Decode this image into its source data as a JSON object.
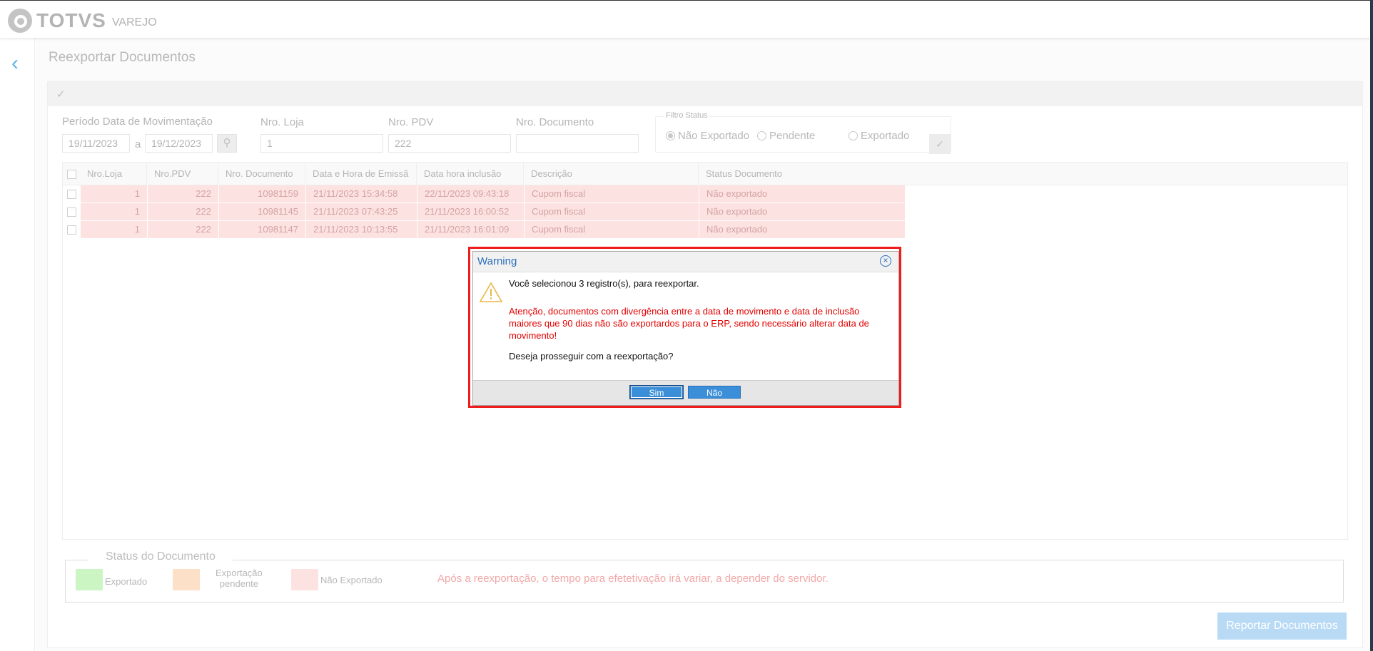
{
  "brand": {
    "name": "TOTVS",
    "sub": "VAREJO"
  },
  "page": {
    "title": "Reexportar Documentos"
  },
  "filters": {
    "periodo_label": "Período Data de Movimentação",
    "date_from": "19/11/2023",
    "date_sep": "a",
    "date_to": "19/12/2023",
    "loja_label": "Nro. Loja",
    "loja_value": "1",
    "pdv_label": "Nro. PDV",
    "pdv_value": "222",
    "documento_label": "Nro. Documento",
    "documento_value": "",
    "status_legend": "Filtro Status",
    "status_options": [
      "Não Exportado",
      "Pendente",
      "Exportado"
    ],
    "status_selected": "Não Exportado"
  },
  "grid": {
    "headers": [
      "Nro.Loja",
      "Nro.PDV",
      "Nro. Documento",
      "Data e Hora de Emissã",
      "Data hora inclusão",
      "Descrição",
      "Status Documento"
    ],
    "rows": [
      [
        "1",
        "222",
        "10981159",
        "21/11/2023 15:34:58",
        "22/11/2023 09:43:18",
        "Cupom fiscal",
        "Não exportado"
      ],
      [
        "1",
        "222",
        "10981145",
        "21/11/2023 07:43:25",
        "21/11/2023 16:00:52",
        "Cupom fiscal",
        "Não exportado"
      ],
      [
        "1",
        "222",
        "10981147",
        "21/11/2023 10:13:55",
        "21/11/2023 16:01:09",
        "Cupom fiscal",
        "Não exportado"
      ]
    ]
  },
  "status_doc": {
    "legend": "Status do Documento",
    "exportado": "Exportado",
    "pendente_1": "Exportação",
    "pendente_2": "pendente",
    "nao_exportado": "Não Exportado",
    "note": "Após a reexportação, o tempo para efetetivação irá variar, a depender do servidor.",
    "colors": {
      "exportado": "#ccf5c4",
      "pendente": "#fde0c8",
      "nao_exportado": "#fde2e2"
    }
  },
  "actions": {
    "export_label": "Reportar Documentos"
  },
  "dialog": {
    "title": "Warning",
    "message": "Você selecionou 3 registro(s), para reexportar.",
    "warning": "Atenção, documentos com divergência entre a data de movimento e data de inclusão maiores que 90 dias não são exportardos para o ERP, sendo necessário alterar data de movimento!",
    "question": "Deseja prosseguir com a reexportação?",
    "yes": "Sim",
    "no": "Não"
  }
}
